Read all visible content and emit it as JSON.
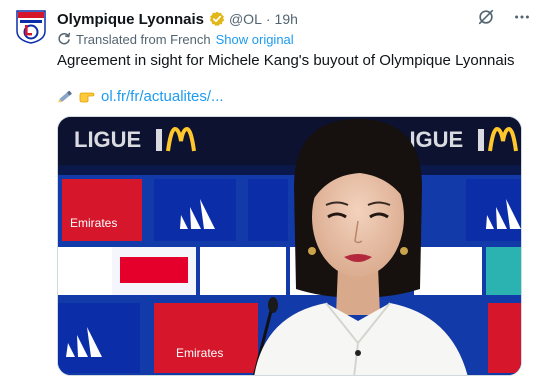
{
  "author": {
    "display_name": "Olympique Lyonnais",
    "handle": "@OL",
    "separator": "·",
    "time_ago": "19h",
    "avatar_icon": "olympique-lyonnais-crest"
  },
  "translation": {
    "label": "Translated from French",
    "show_original": "Show original"
  },
  "post": {
    "text": "Agreement in sight for Michele Kang's buyout of Olympique Lyonnais",
    "link_text": "ol.fr/fr/actualites/...",
    "emojis": [
      "pen-icon",
      "pointing-hand-icon"
    ]
  },
  "media": {
    "description_icons": [
      "ligue1-banner",
      "adidas-logo",
      "emirates-logo",
      "ol-crest",
      "microphone"
    ]
  },
  "colors": {
    "link": "#1d9bf0",
    "secondary_text": "#536471",
    "verified_gold": "#e2b719",
    "ol_blue": "#0b2ea8",
    "ol_red": "#d6162b"
  }
}
